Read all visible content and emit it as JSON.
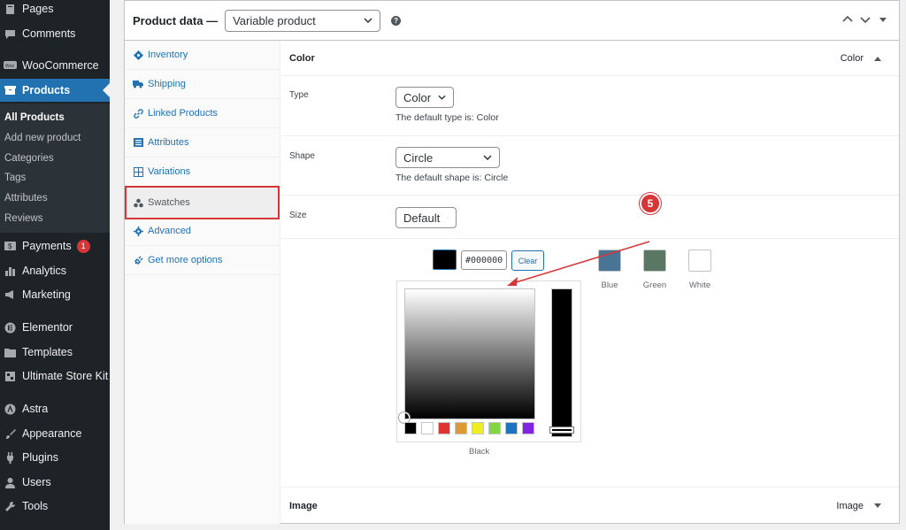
{
  "admin_menu": {
    "top_items": [
      {
        "label": "Pages",
        "icon": "pages-icon"
      },
      {
        "label": "Comments",
        "icon": "comments-icon"
      },
      {
        "label": "WooCommerce",
        "icon": "woocommerce-icon"
      },
      {
        "label": "Products",
        "icon": "products-icon"
      }
    ],
    "products_submenu": [
      "All Products",
      "Add new product",
      "Categories",
      "Tags",
      "Attributes",
      "Reviews"
    ],
    "bottom_items": [
      {
        "label": "Payments",
        "icon": "payments-icon",
        "badge": "1"
      },
      {
        "label": "Analytics",
        "icon": "analytics-icon"
      },
      {
        "label": "Marketing",
        "icon": "marketing-icon"
      },
      {
        "label": "Elementor",
        "icon": "elementor-icon"
      },
      {
        "label": "Templates",
        "icon": "templates-icon"
      },
      {
        "label": "Ultimate Store Kit",
        "icon": "store-kit-icon"
      },
      {
        "label": "Astra",
        "icon": "astra-icon"
      },
      {
        "label": "Appearance",
        "icon": "appearance-icon"
      },
      {
        "label": "Plugins",
        "icon": "plugins-icon"
      },
      {
        "label": "Users",
        "icon": "users-icon"
      },
      {
        "label": "Tools",
        "icon": "tools-icon"
      }
    ],
    "active": "Products",
    "active_sub": "All Products"
  },
  "product_data": {
    "title": "Product data —",
    "product_type": "Variable product",
    "help": "?"
  },
  "tabs": [
    {
      "label": "Inventory",
      "icon": "inventory-icon"
    },
    {
      "label": "Shipping",
      "icon": "shipping-icon"
    },
    {
      "label": "Linked Products",
      "icon": "link-icon"
    },
    {
      "label": "Attributes",
      "icon": "attributes-icon"
    },
    {
      "label": "Variations",
      "icon": "variations-icon"
    },
    {
      "label": "Swatches",
      "icon": "swatches-icon",
      "active": true
    },
    {
      "label": "Advanced",
      "icon": "gear-icon"
    },
    {
      "label": "Get more options",
      "icon": "plug-icon"
    }
  ],
  "color_section": {
    "heading": "Color",
    "right_label": "Color",
    "type": {
      "label": "Type",
      "value": "Color",
      "desc": "The default type is: Color"
    },
    "shape": {
      "label": "Shape",
      "value": "Circle",
      "desc": "The default shape is: Circle"
    },
    "size": {
      "label": "Size",
      "value": "Default"
    },
    "picker": {
      "hex": "#000000",
      "clear_label": "Clear",
      "selected_label": "Black",
      "palette": [
        "#000000",
        "#ffffff",
        "#dd3333",
        "#dd9933",
        "#eeee22",
        "#81d742",
        "#1e73be",
        "#8224e3"
      ]
    },
    "swatches": [
      {
        "label": "Blue",
        "color": "#4a7493"
      },
      {
        "label": "Green",
        "color": "#5a7763"
      },
      {
        "label": "White",
        "color": "#ffffff"
      }
    ]
  },
  "image_section": {
    "heading": "Image",
    "right_label": "Image"
  },
  "annotation": {
    "step": "5",
    "color": "#d63638"
  }
}
